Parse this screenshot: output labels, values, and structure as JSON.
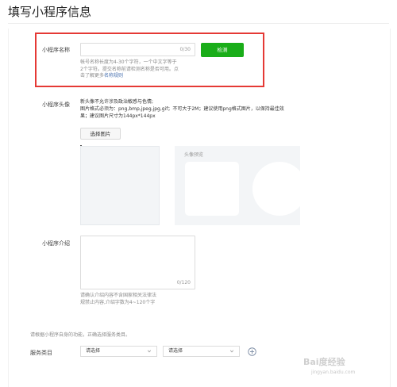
{
  "header": {
    "title": "填写小程序信息"
  },
  "name_section": {
    "label": "小程序名称",
    "input_value": "",
    "counter": "0/30",
    "check_button": "检测",
    "help_line1": "帐号名称长度为4-30个字符，一个中文字等于",
    "help_line2": "2个字符。提交名称前请检测名称是否可用。点",
    "help_line3_prefix": "击了解更多",
    "help_link": "名称规则"
  },
  "avatar_section": {
    "label": "小程序头像",
    "rule_line1": "新头像不允许涉及政治敏感与色情;",
    "rule_line2": "图片格式必须为：png,bmp,jpeg,jpg,gif；不可大于2M；建议使用png格式图片，以保持最佳效",
    "rule_line3": "果；建议图片尺寸为144px*144px",
    "choose_button": "选择图片",
    "preview_label": "头像预览"
  },
  "intro_section": {
    "label": "小程序介绍",
    "textarea_value": "",
    "counter": "0/120",
    "help_line1": "请确认介绍内容不含国家相关法律法",
    "help_line2": "规禁止内容,介绍字数为4~120个字"
  },
  "category_section": {
    "hint": "请根据小程序自身的功能，正确选择服务类目。",
    "label": "服务类目",
    "select1": "请选择",
    "select2": "请选择"
  },
  "watermark": {
    "text": "Bai度经验",
    "url": "jingyan.baidu.com"
  },
  "colors": {
    "accent_green": "#1aad19",
    "highlight_red": "#e53935",
    "link_blue": "#4a72b0"
  }
}
